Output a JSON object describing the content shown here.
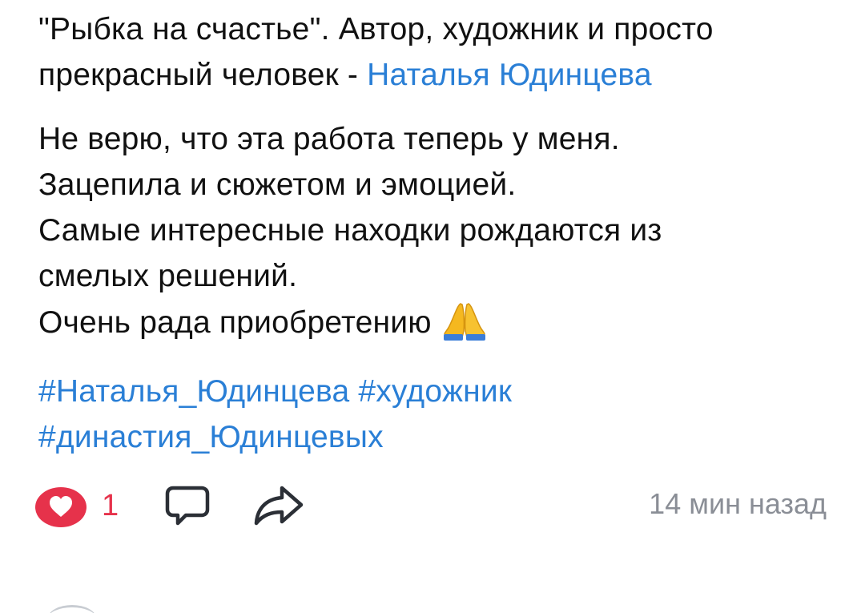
{
  "post": {
    "intro_line1": "\"Рыбка на счастье\". Автор, художник и просто",
    "intro_line2_prefix": "прекрасный человек - ",
    "author_link": "Наталья Юдинцева",
    "body_lines": [
      "Не верю, что эта работа теперь у меня.",
      "Зацепила и сюжетом и эмоцией.",
      "Самые интересные находки рождаются из",
      "смелых решений.",
      "Очень рада приобретению"
    ],
    "emoji_icon": "folded-hands-icon",
    "hashtags": [
      "#Наталья_Юдинцева",
      "#художник",
      "#династия_Юдинцевых"
    ]
  },
  "actions": {
    "like_count": "1",
    "timestamp": "14 мин назад",
    "like_icon": "heart-icon",
    "comment_icon": "comment-icon",
    "share_icon": "share-icon"
  },
  "colors": {
    "link": "#2a7fd6",
    "like": "#e6324b",
    "muted": "#8a8e96",
    "text": "#111111"
  }
}
